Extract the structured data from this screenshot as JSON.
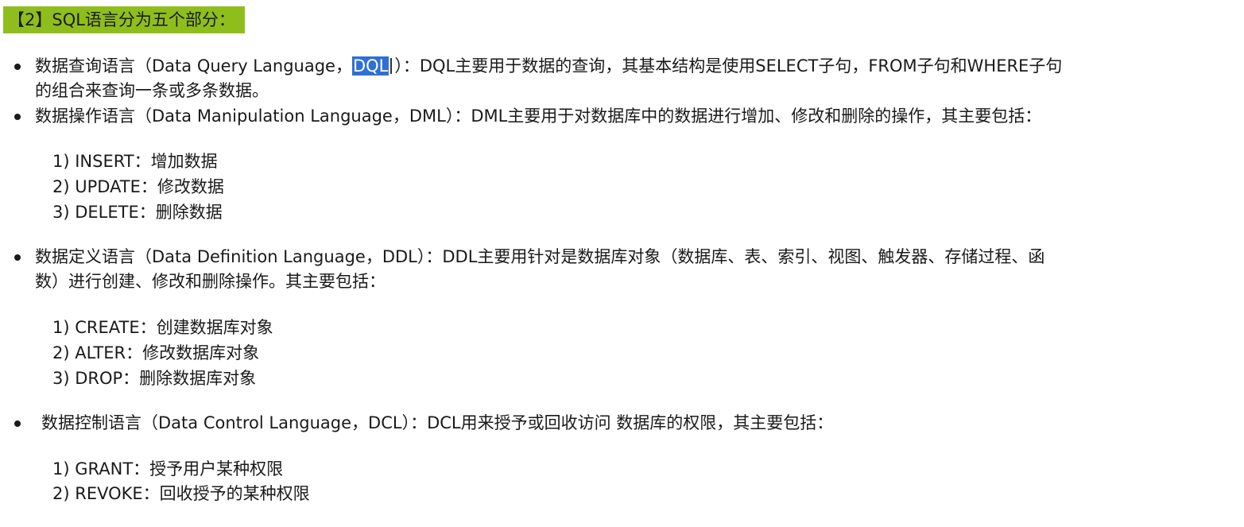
{
  "heading": "【2】SQL语言分为五个部分：",
  "dql": {
    "line1_pre": "数据查询语言（Data Query Language，",
    "highlight": "DQL",
    "line1_post": "）：DQL主要用于数据的查询，其基本结构是使用SELECT子句，FROM子句和WHERE子句",
    "line2": "的组合来查询一条或多条数据。"
  },
  "dml": {
    "line1": "数据操作语言（Data Manipulation Language，DML）：DML主要用于对数据库中的数据进行增加、修改和删除的操作，其主要包括：",
    "items": [
      "1) INSERT：增加数据",
      "2) UPDATE：修改数据",
      "3) DELETE：删除数据"
    ]
  },
  "ddl": {
    "line1": "数据定义语言（Data Definition Language，DDL）：DDL主要用针对是数据库对象（数据库、表、索引、视图、触发器、存储过程、函",
    "line2": "数）进行创建、修改和删除操作。其主要包括：",
    "items": [
      "1) CREATE：创建数据库对象",
      "2) ALTER：修改数据库对象",
      "3) DROP：删除数据库对象"
    ]
  },
  "dcl": {
    "line1": "数据控制语言（Data Control Language，DCL）：DCL用来授予或回收访问 数据库的权限，其主要包括：",
    "items": [
      "1) GRANT：授予用户某种权限",
      "2) REVOKE：回收授予的某种权限"
    ]
  }
}
